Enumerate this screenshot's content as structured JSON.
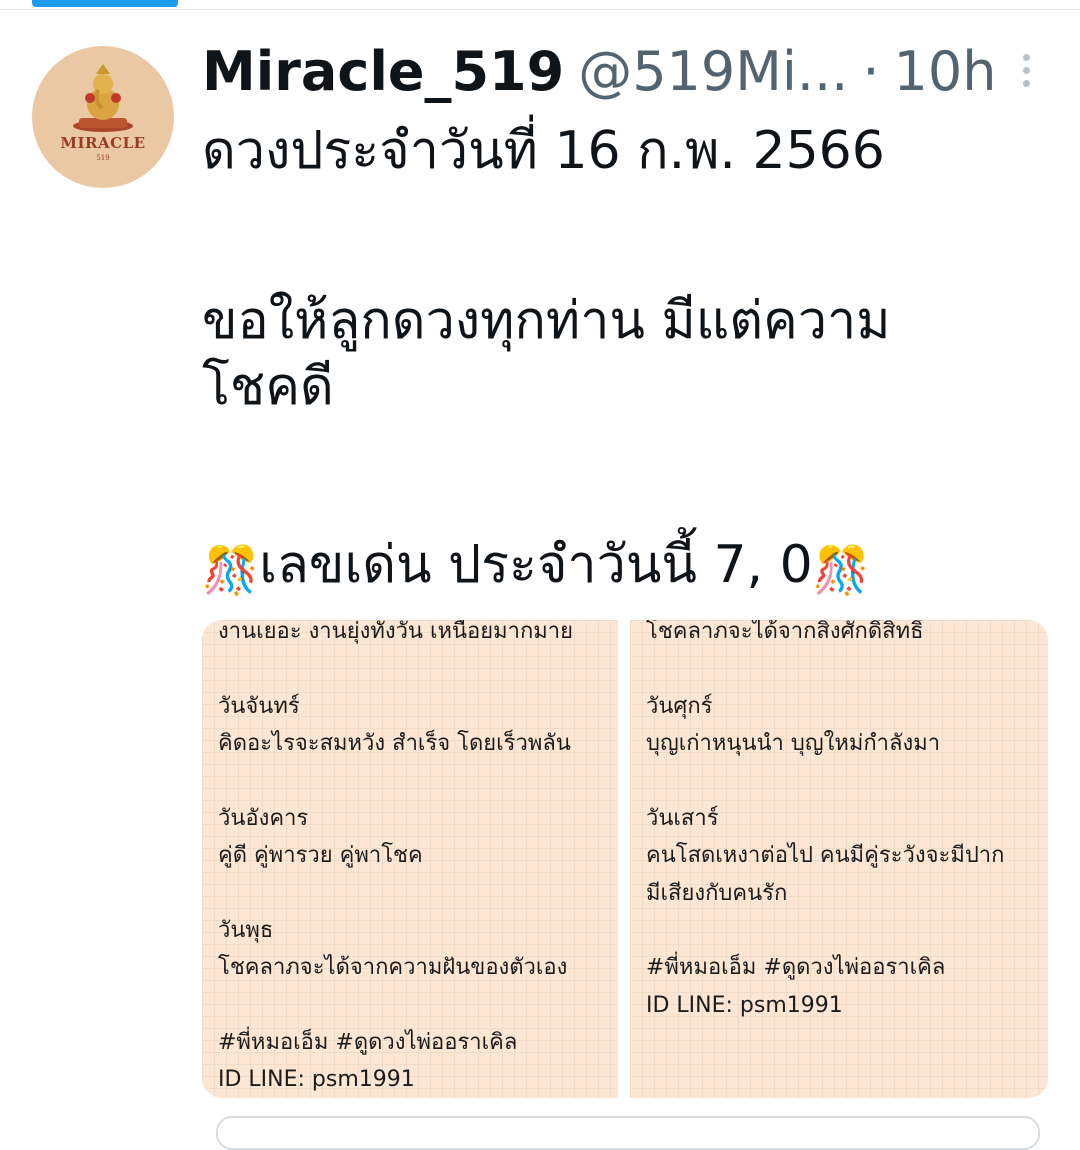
{
  "tweet": {
    "display_name": "Miracle_519",
    "handle": "@519Mi...",
    "separator": "·",
    "time": "10h",
    "more_icon": "more-vertical-icon",
    "line1": "ดวงประจำวันที่ 16 ก.พ. 2566",
    "line2": "ขอให้ลูกดวงทุกท่าน มีแต่ความ",
    "line3": "โชคดี",
    "line4_prefix_emoji": "🎊",
    "line4_text": "เลขเด่น ประจำวันนี้  7, 0",
    "line4_suffix_emoji": "🎊"
  },
  "avatar": {
    "brand": "MIRACLE",
    "sub": "519",
    "background": "#eac8a4"
  },
  "images": {
    "left": {
      "top_line": "งานเยอะ งานยุ่งทั้งวัน เหนือยมากมาย",
      "day1": "วันจันทร์",
      "day1_text": "คิดอะไรจะสมหวัง สำเร็จ โดยเร็วพลัน",
      "day2": "วันอังคาร",
      "day2_text": "คู่ดี คู่พารวย คู่พาโชค",
      "day3": "วันพุธ",
      "day3_text": "โชคลาภจะได้จากความฝันของตัวเอง",
      "hashtags": "#พี่หมอเอ็ม #ดูดวงไพ่ออราเคิล",
      "line_id": "ID LINE: psm1991"
    },
    "right": {
      "top_line": "โชคลาภจะได้จากสิ่งศักดิ์สิทธิ์",
      "day1": "วันศุกร์",
      "day1_text": "บุญเก่าหนุนนำ บุญใหม่กำลังมา",
      "day2": "วันเสาร์",
      "day2_text1": "คนโสดเหงาต่อไป  คนมีคู่ระวังจะมีปาก",
      "day2_text2": "มีเสียงกับคนรัก",
      "hashtags": "#พี่หมอเอ็ม #ดูดวงไพ่ออราเคิล",
      "line_id": "ID LINE: psm1991"
    }
  }
}
